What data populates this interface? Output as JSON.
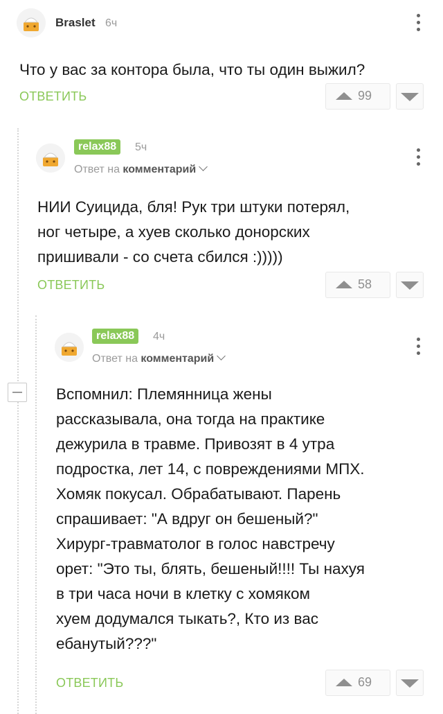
{
  "comments": [
    {
      "author": "Braslet",
      "time": "6ч",
      "text_lines": [
        "Что у вас за контора была, что ты один выжил?"
      ],
      "reply_label": "ОТВЕТИТЬ",
      "votes": "99"
    },
    {
      "author": "relax88",
      "time": "5ч",
      "reply_prefix": "Ответ на",
      "reply_target": "комментарий",
      "text_lines": [
        "НИИ Суицида, бля! Рук три штуки потерял,",
        "ног четыре, а хуев сколько донорских",
        "пришивали - со счета сбился :)))))"
      ],
      "reply_label": "ОТВЕТИТЬ",
      "votes": "58"
    },
    {
      "author": "relax88",
      "time": "4ч",
      "reply_prefix": "Ответ на",
      "reply_target": "комментарий",
      "text_lines": [
        "Вспомнил: Племянница жены",
        "рассказывала, она тогда на практике",
        "дежурила в травме. Привозят в 4 утра",
        "подростка, лет 14, с повреждениями МПХ.",
        "Хомяк покусал. Обрабатывают. Парень",
        "спрашивает: \"А вдруг он бешеный?\"",
        "Хирург-травматолог в голос навстречу",
        "орет: \"Это ты, блять, бешеный!!!! Ты нахуя",
        "в три часа ночи в клетку с хомяком",
        "хуем додумался тыкать?, Кто из вас",
        "ебанутый???\""
      ],
      "reply_label": "ОТВЕТИТЬ",
      "votes": "69"
    }
  ],
  "icons": {
    "avatar": "default-avatar-icon",
    "more": "more-vertical-icon",
    "upvote": "arrow-up-icon",
    "downvote": "arrow-down-icon",
    "collapse": "collapse-minus-icon"
  },
  "colors": {
    "accent": "#8ac858",
    "muted": "#9a9a9a"
  }
}
